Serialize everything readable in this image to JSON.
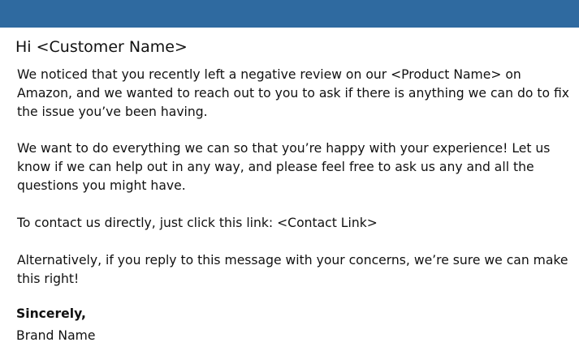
{
  "header": {
    "bar_color": "#2f6aa0"
  },
  "email": {
    "greeting": "Hi <Customer Name>",
    "paragraphs": [
      "We noticed that you recently left a negative review on our <Product Name> on Amazon, and we wanted to reach out to you to ask if there is anything we can do to fix the issue you’ve been having.",
      "We want to do everything we can so that you’re happy with your experience! Let us know if we can help out in any way, and please feel free to ask us any and all the questions you might have.",
      "To contact us directly, just click this link: <Contact Link>",
      "Alternatively, if you reply to this message with your concerns, we’re sure we can make this right!"
    ],
    "signoff": "Sincerely,",
    "signature": "Brand Name"
  }
}
